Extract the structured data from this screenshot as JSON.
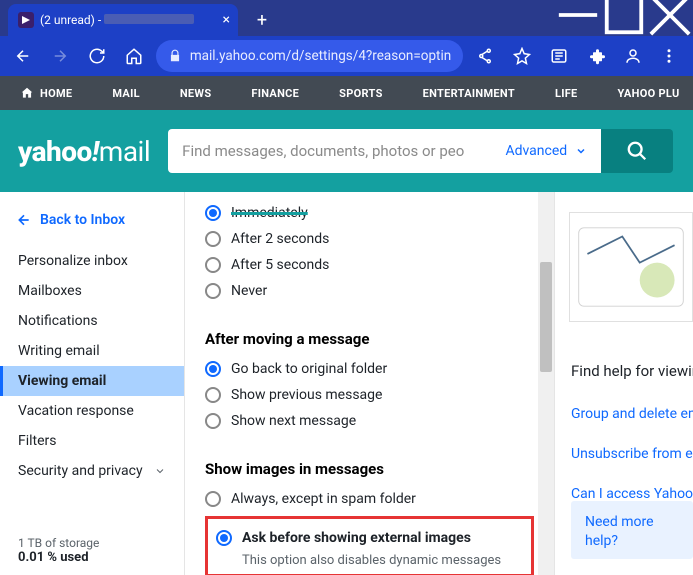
{
  "browser": {
    "tab_title_prefix": "(2 unread) - ",
    "url": "mail.yahoo.com/d/settings/4?reason=optin"
  },
  "yahoo_nav": [
    "HOME",
    "MAIL",
    "NEWS",
    "FINANCE",
    "SPORTS",
    "ENTERTAINMENT",
    "LIFE",
    "YAHOO PLU"
  ],
  "header": {
    "logo_main": "yahoo",
    "logo_sub": "mail",
    "search_placeholder": "Find messages, documents, photos or peo",
    "advanced": "Advanced"
  },
  "sidebar": {
    "back": "Back to Inbox",
    "items": [
      "Personalize inbox",
      "Mailboxes",
      "Notifications",
      "Writing email",
      "Viewing email",
      "Vacation response",
      "Filters",
      "Security and privacy"
    ],
    "active_index": 4,
    "storage_line1": "1 TB of storage",
    "storage_line2": "0.01 % used"
  },
  "settings": {
    "preview_delay": {
      "options": [
        "Immediately",
        "After 2 seconds",
        "After 5 seconds",
        "Never"
      ],
      "selected": 0
    },
    "after_moving": {
      "title": "After moving a message",
      "options": [
        "Go back to original folder",
        "Show previous message",
        "Show next message"
      ],
      "selected": 0
    },
    "show_images": {
      "title": "Show images in messages",
      "options": [
        "Always, except in spam folder",
        "Ask before showing external images"
      ],
      "selected": 1,
      "sub": "This option also disables dynamic messages"
    }
  },
  "help": {
    "title": "Find help for viewing",
    "links": [
      "Group and delete em",
      "Unsubscribe from em",
      "Can I access Yahoo M"
    ],
    "more": "Need more help?"
  }
}
